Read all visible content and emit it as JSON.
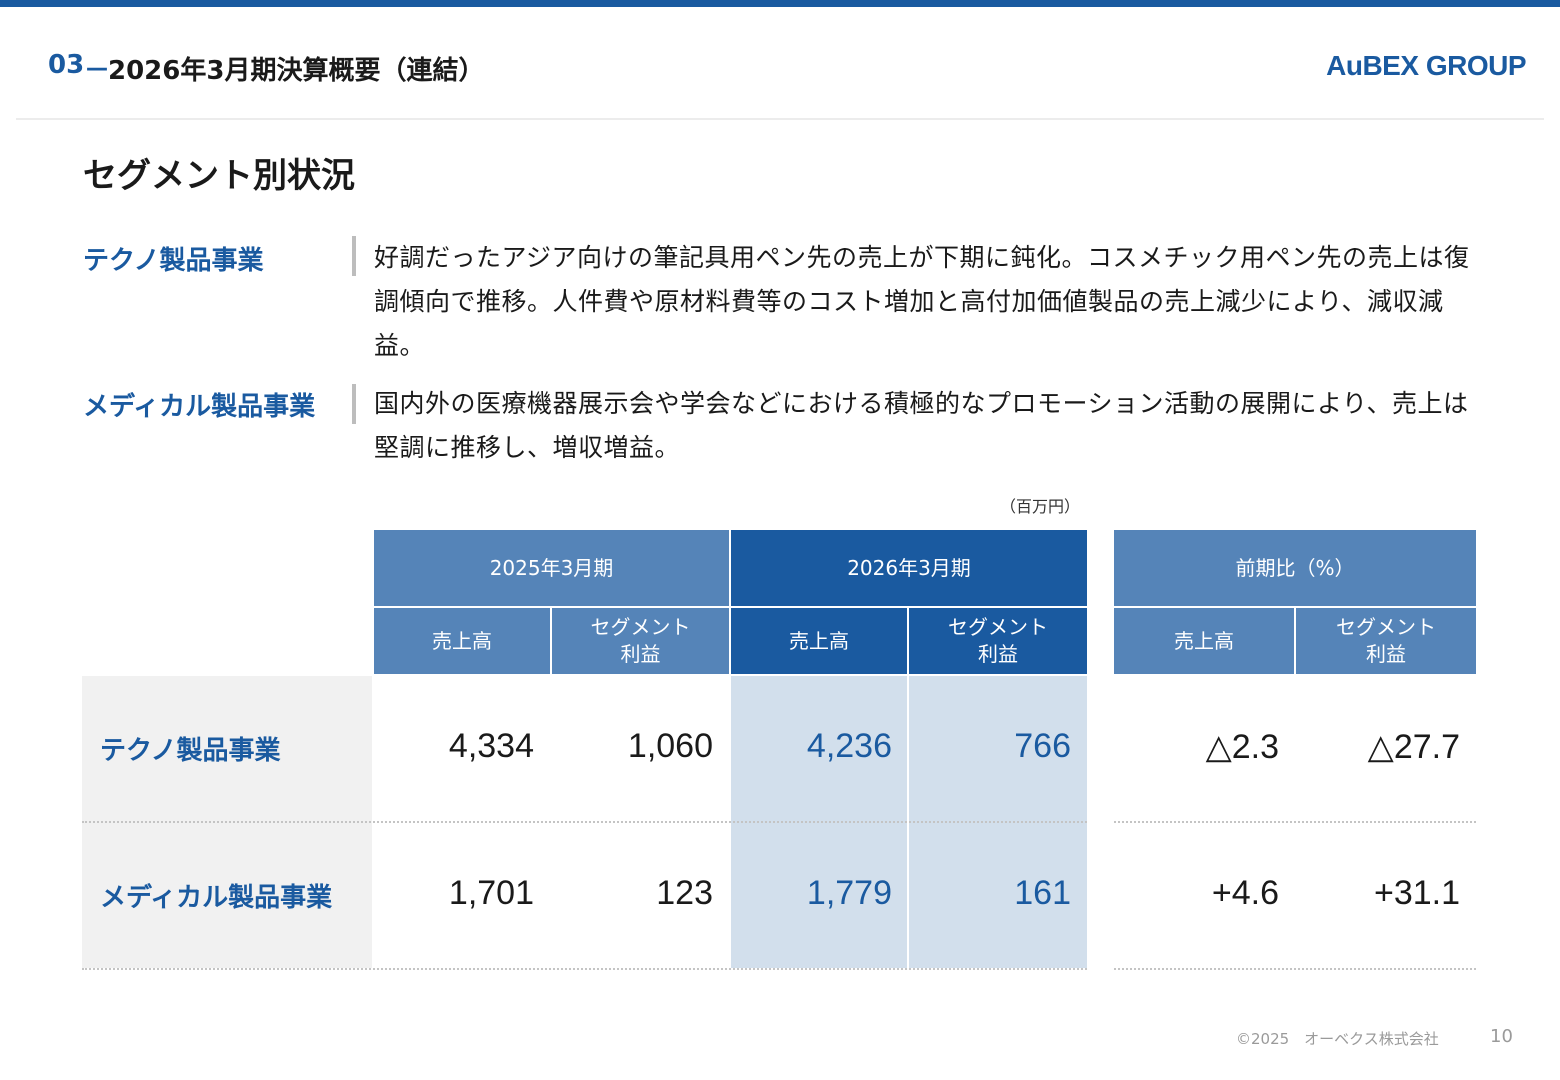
{
  "header": {
    "section_number": "03",
    "dash": "－",
    "title": "2026年3月期決算概要（連結）",
    "logo": "AuBEX GROUP"
  },
  "page_title": "セグメント別状況",
  "segments": [
    {
      "name": "テクノ製品事業",
      "description": "好調だったアジア向けの筆記具用ペン先の売上が下期に鈍化。コスメチック用ペン先の売上は復調傾向で推移。人件費や原材料費等のコスト増加と高付加価値製品の売上減少により、減収減益。"
    },
    {
      "name": "メディカル製品事業",
      "description": "国内外の医療機器展示会や学会などにおける積極的なプロモーション活動の展開により、売上は堅調に推移し、増収増益。"
    }
  ],
  "table": {
    "unit": "（百万円）",
    "group_headers": [
      "2025年3月期",
      "2026年3月期",
      "前期比（%）"
    ],
    "col_sales": "売上高",
    "col_profit_line1": "セグメント",
    "col_profit_line2": "利益",
    "rows": [
      {
        "label": "テクノ製品事業",
        "fy2025_sales": "4,334",
        "fy2025_profit": "1,060",
        "fy2026_sales": "4,236",
        "fy2026_profit": "766",
        "yoy_sales": "△2.3",
        "yoy_profit": "△27.7"
      },
      {
        "label": "メディカル製品事業",
        "fy2025_sales": "1,701",
        "fy2025_profit": "123",
        "fy2026_sales": "1,779",
        "fy2026_profit": "161",
        "yoy_sales": "+4.6",
        "yoy_profit": "+31.1"
      }
    ]
  },
  "footer": {
    "copyright": "©2025　オーベクス株式会社",
    "page_number": "10"
  },
  "colors": {
    "brand_blue": "#1a5aa0",
    "header_light": "#5584b8",
    "highlight": "#d2dfec",
    "label_bg": "#f1f1f1"
  }
}
